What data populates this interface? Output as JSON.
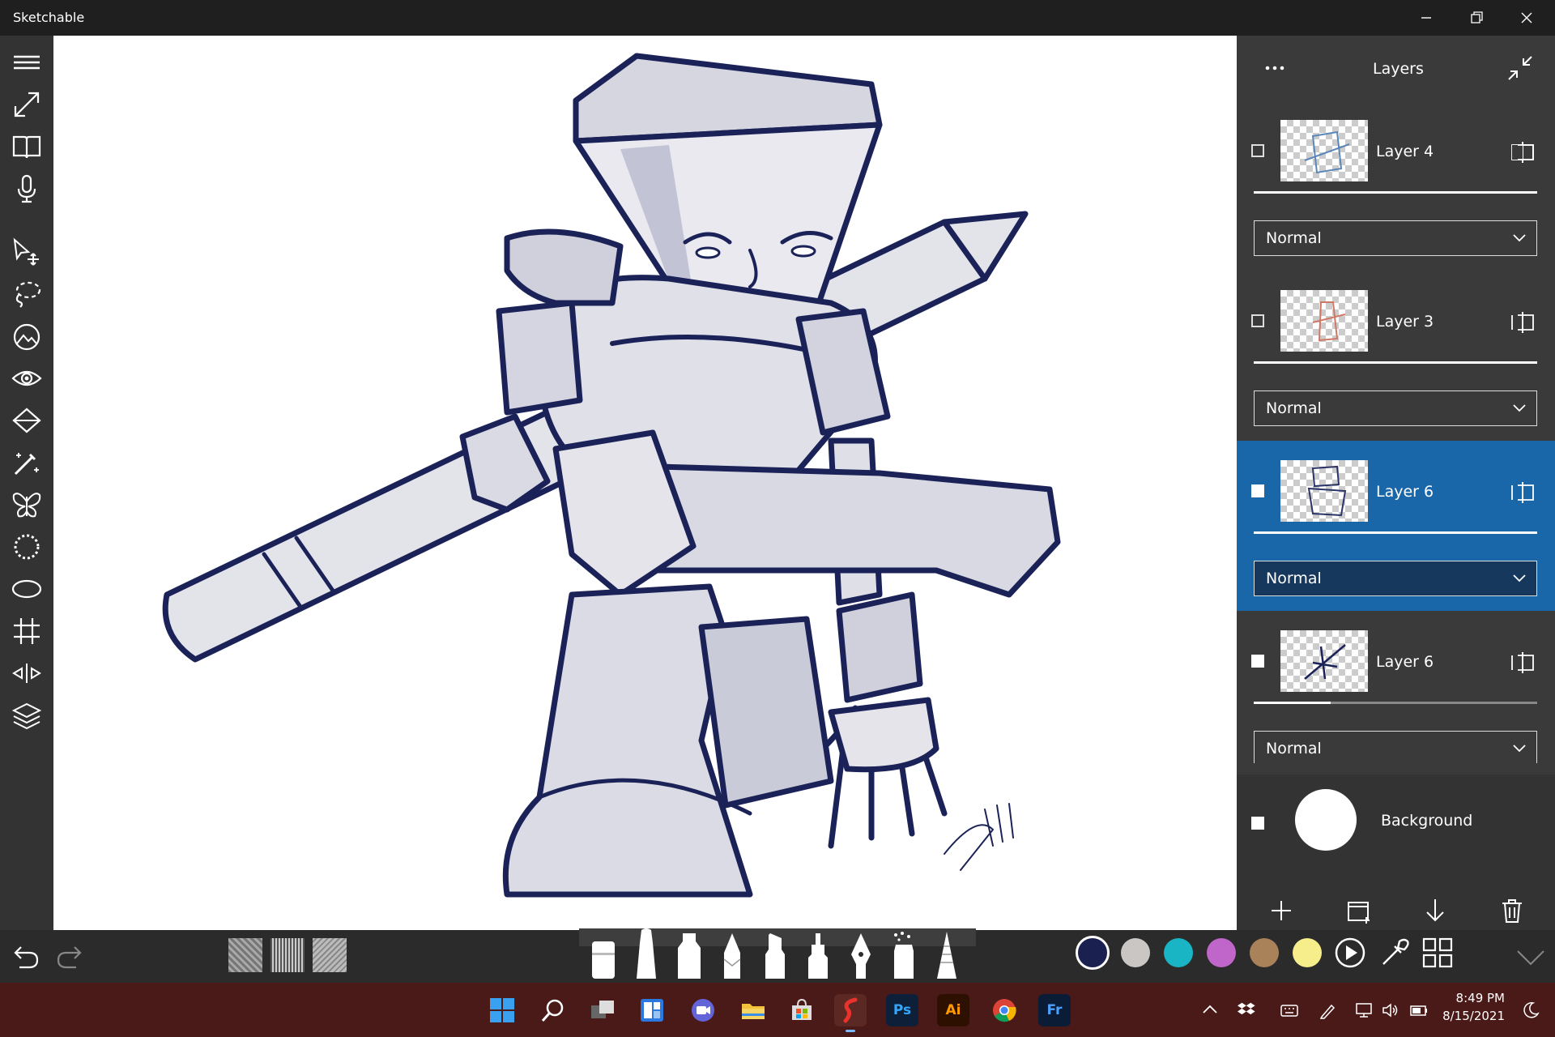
{
  "app": {
    "title": "Sketchable"
  },
  "panel": {
    "title": "Layers",
    "layers": [
      {
        "name": "Layer 4",
        "blend": "Normal",
        "selected": false
      },
      {
        "name": "Layer 3",
        "blend": "Normal",
        "selected": false
      },
      {
        "name": "Layer 6",
        "blend": "Normal",
        "selected": true
      },
      {
        "name": "Layer 6",
        "blend": "Normal",
        "selected": false
      }
    ],
    "background_label": "Background"
  },
  "palette": {
    "colors": [
      "#1a2150",
      "#c9c6c4",
      "#1ab5c4",
      "#c065c9",
      "#a9825a",
      "#f5ee8a"
    ]
  },
  "taskbar": {
    "time": "8:49 PM",
    "date": "8/15/2021",
    "apps": [
      {
        "name": "start",
        "glyph": ""
      },
      {
        "name": "search",
        "glyph": ""
      },
      {
        "name": "task-view",
        "glyph": ""
      },
      {
        "name": "widgets",
        "glyph": ""
      },
      {
        "name": "teams",
        "glyph": ""
      },
      {
        "name": "file-explorer",
        "glyph": ""
      },
      {
        "name": "store",
        "glyph": ""
      },
      {
        "name": "sketchable",
        "glyph": ""
      },
      {
        "name": "photoshop",
        "glyph": "Ps"
      },
      {
        "name": "illustrator",
        "glyph": "Ai"
      },
      {
        "name": "chrome",
        "glyph": ""
      },
      {
        "name": "fresco",
        "glyph": "Fr"
      }
    ]
  },
  "accent_color": "#1966a8"
}
